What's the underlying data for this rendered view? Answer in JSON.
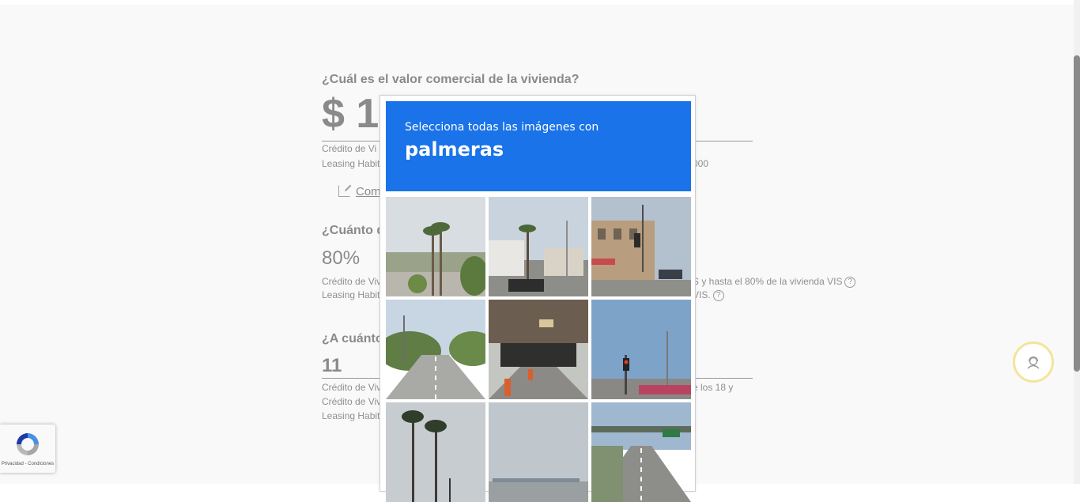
{
  "form": {
    "q1": {
      "question": "¿Cuál es el valor comercial de la vivienda?",
      "value": "$ 1",
      "note1": "Crédito de Vi",
      "note2": "Leasing Habit",
      "note_right": "000"
    },
    "compare_link": "Com",
    "q2": {
      "question": "¿Cuánto d",
      "value": "80%",
      "note1": "Crédito de Viv",
      "note2": "Leasing Habit",
      "note1_right": "S y hasta el 80% de la vivienda VIS",
      "note2_right": "VIS."
    },
    "q3": {
      "question": "¿A cuánto",
      "value": "11",
      "note1": "Crédito de Viv",
      "note2": "Crédito de Viv",
      "note3": "Leasing Habit",
      "note1_right": "e los 18 y"
    },
    "help_symbol": "?"
  },
  "captcha": {
    "instruction": "Selecciona todas las imágenes con",
    "target": "palmeras",
    "tiles": [
      "tile-palms-street",
      "tile-palm-intersection",
      "tile-brick-building",
      "tile-tree-highway",
      "tile-overpass-tunnel",
      "tile-traffic-light-street",
      "tile-tall-palms",
      "tile-overcast-road",
      "tile-highway-overpass"
    ]
  },
  "recaptcha": {
    "footer": "Privacidad - Condiciones"
  },
  "colors": {
    "captcha_header": "#1a73e8",
    "support_ring": "#f3e49a",
    "text_gray": "#8a8a8a"
  }
}
